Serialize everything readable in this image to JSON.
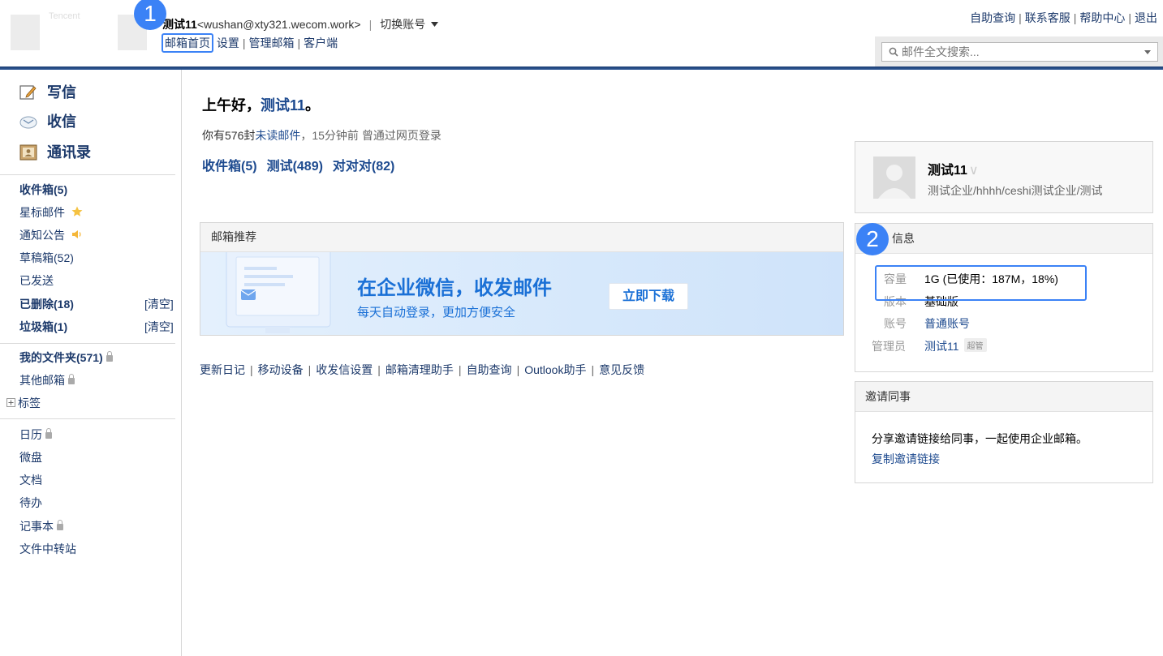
{
  "header": {
    "logo_text": "Tencent",
    "user_name": "测试11",
    "user_email": "<wushan@xty321.wecom.work>",
    "separator": "|",
    "switch_account": "切换账号",
    "nav": [
      "邮箱首页",
      "设置",
      "管理邮箱",
      "客户端"
    ],
    "top_links": [
      "自助查询",
      "联系客服",
      "帮助中心",
      "退出"
    ],
    "search_placeholder": "邮件全文搜索..."
  },
  "markers": [
    "1",
    "2"
  ],
  "sidebar": {
    "actions": [
      {
        "label": "写信",
        "icon": "compose-icon"
      },
      {
        "label": "收信",
        "icon": "inbox-icon"
      },
      {
        "label": "通讯录",
        "icon": "contacts-icon"
      }
    ],
    "folders": [
      {
        "label": "收件箱(5)",
        "bold": true
      },
      {
        "label": "星标邮件",
        "icon": "star-icon"
      },
      {
        "label": "通知公告",
        "icon": "speaker-icon"
      },
      {
        "label": "草稿箱(52)"
      },
      {
        "label": "已发送"
      },
      {
        "label": "已删除(18)",
        "bold": true,
        "clear": "[清空]"
      },
      {
        "label": "垃圾箱(1)",
        "bold": true,
        "clear": "[清空]"
      }
    ],
    "my_folders": "我的文件夹(571)",
    "other_mail": "其他邮箱",
    "tags": "标签",
    "apps": [
      "日历",
      "微盘",
      "文档",
      "待办",
      "记事本",
      "文件中转站"
    ]
  },
  "main": {
    "greeting_prefix": "上午好，",
    "greeting_name": "测试11",
    "greeting_suffix": "。",
    "unread_prefix": "你有576封",
    "unread_link": "未读邮件",
    "unread_suffix": "，15分钟前 曾通过网页登录",
    "folder_links": [
      "收件箱(5)",
      "测试(489)",
      "对对对(82)"
    ],
    "recommend_title": "邮箱推荐",
    "banner_title": "在企业微信，收发邮件",
    "banner_subtitle": "每天自动登录，更加方便安全",
    "download_label": "立即下载",
    "bottom_links": [
      "更新日记",
      "移动设备",
      "收发信设置",
      "邮箱清理助手",
      "自助查询",
      "Outlook助手",
      "意见反馈"
    ],
    "bottom_sep": "|"
  },
  "profile": {
    "name": "测试11",
    "verified_mark": "∨",
    "department": "测试企业/hhhh/ceshi测试企业/测试"
  },
  "info": {
    "title": "信息",
    "rows": [
      {
        "key": "容量",
        "value": "1G (已使用：187M，18%)"
      },
      {
        "key": "版本",
        "value": "基础版"
      },
      {
        "key": "账号",
        "value": "普通账号"
      },
      {
        "key": "管理员",
        "value": "测试11",
        "badge": "超管"
      }
    ]
  },
  "invite": {
    "title": "邀请同事",
    "text": "分享邀请链接给同事，一起使用企业邮箱。",
    "copy_link": "复制邀请链接"
  },
  "colors": {
    "link": "#1d4a8f",
    "header_line": "#1e3f73",
    "highlight": "#3b82f6",
    "banner_blue": "#1a70d6"
  }
}
